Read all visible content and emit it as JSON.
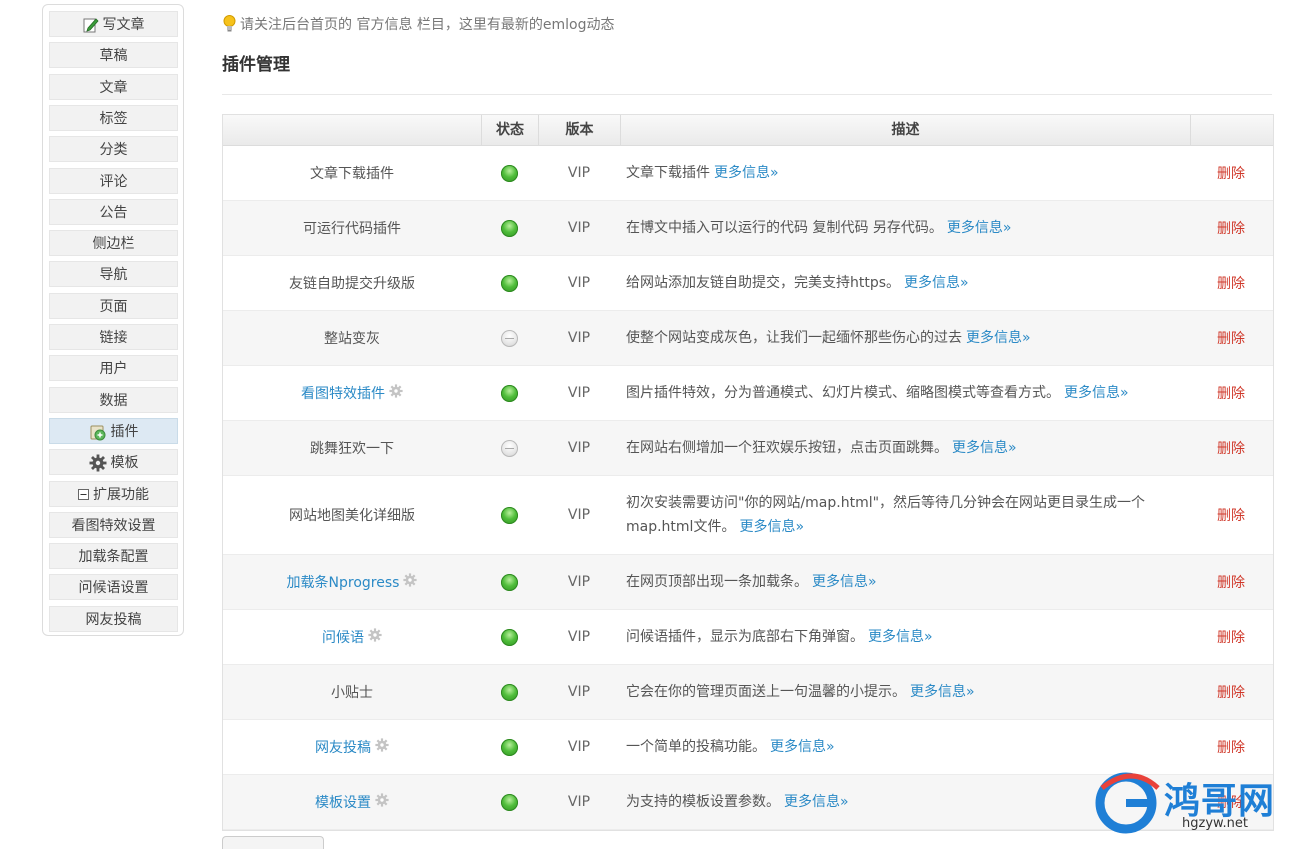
{
  "sidebar": {
    "items": [
      {
        "label": "写文章",
        "icon": "edit-icon"
      },
      {
        "label": "草稿"
      },
      {
        "label": "文章"
      },
      {
        "label": "标签"
      },
      {
        "label": "分类"
      },
      {
        "label": "评论"
      },
      {
        "label": "公告"
      },
      {
        "label": "侧边栏"
      },
      {
        "label": "导航"
      },
      {
        "label": "页面"
      },
      {
        "label": "链接"
      },
      {
        "label": "用户"
      },
      {
        "label": "数据"
      },
      {
        "label": "插件",
        "icon": "plugin-icon",
        "active": true
      },
      {
        "label": "模板",
        "icon": "gear-icon"
      },
      {
        "label": "扩展功能",
        "icon": "collapse-icon"
      },
      {
        "label": "看图特效设置"
      },
      {
        "label": "加载条配置"
      },
      {
        "label": "问候语设置"
      },
      {
        "label": "网友投稿"
      }
    ]
  },
  "notice": {
    "text": "请关注后台首页的 官方信息 栏目，这里有最新的emlog动态"
  },
  "page_title": "插件管理",
  "table": {
    "headers": {
      "name": "",
      "state": "状态",
      "version": "版本",
      "desc": "描述",
      "action": ""
    },
    "more_label": "更多信息»",
    "delete_label": "删除",
    "rows": [
      {
        "name": "文章下载插件",
        "link": false,
        "gear": false,
        "on": true,
        "version": "VIP",
        "desc": "文章下载插件"
      },
      {
        "name": "可运行代码插件",
        "link": false,
        "gear": false,
        "on": true,
        "version": "VIP",
        "desc": "在博文中插入可以运行的代码 复制代码 另存代码。"
      },
      {
        "name": "友链自助提交升级版",
        "link": false,
        "gear": false,
        "on": true,
        "version": "VIP",
        "desc": "给网站添加友链自助提交，完美支持https。"
      },
      {
        "name": "整站变灰",
        "link": false,
        "gear": false,
        "on": false,
        "version": "VIP",
        "desc": "使整个网站变成灰色，让我们一起缅怀那些伤心的过去"
      },
      {
        "name": "看图特效插件",
        "link": true,
        "gear": true,
        "on": true,
        "version": "VIP",
        "desc": "图片插件特效，分为普通模式、幻灯片模式、缩略图模式等查看方式。"
      },
      {
        "name": "跳舞狂欢一下",
        "link": false,
        "gear": false,
        "on": false,
        "version": "VIP",
        "desc": "在网站右侧增加一个狂欢娱乐按钮，点击页面跳舞。"
      },
      {
        "name": "网站地图美化详细版",
        "link": false,
        "gear": false,
        "on": true,
        "version": "VIP",
        "desc": "初次安装需要访问\"你的网站/map.html\"，然后等待几分钟会在网站更目录生成一个map.html文件。"
      },
      {
        "name": "加载条Nprogress",
        "link": true,
        "gear": true,
        "on": true,
        "version": "VIP",
        "desc": "在网页顶部出现一条加载条。"
      },
      {
        "name": "问候语",
        "link": true,
        "gear": true,
        "on": true,
        "version": "VIP",
        "desc": "问候语插件，显示为底部右下角弹窗。"
      },
      {
        "name": "小贴士",
        "link": false,
        "gear": false,
        "on": true,
        "version": "VIP",
        "desc": "它会在你的管理页面送上一句温馨的小提示。"
      },
      {
        "name": "网友投稿",
        "link": true,
        "gear": true,
        "on": true,
        "version": "VIP",
        "desc": "一个简单的投稿功能。"
      },
      {
        "name": "模板设置",
        "link": true,
        "gear": true,
        "on": true,
        "version": "VIP",
        "desc": "为支持的模板设置参数。"
      }
    ]
  },
  "watermark": {
    "name": "鸿哥网",
    "url": "hgzyw.net"
  },
  "colors": {
    "link": "#2b8ac6",
    "delete": "#d0392b",
    "enabled": "#4fbd3a",
    "watermark": "#1f7fd6"
  }
}
